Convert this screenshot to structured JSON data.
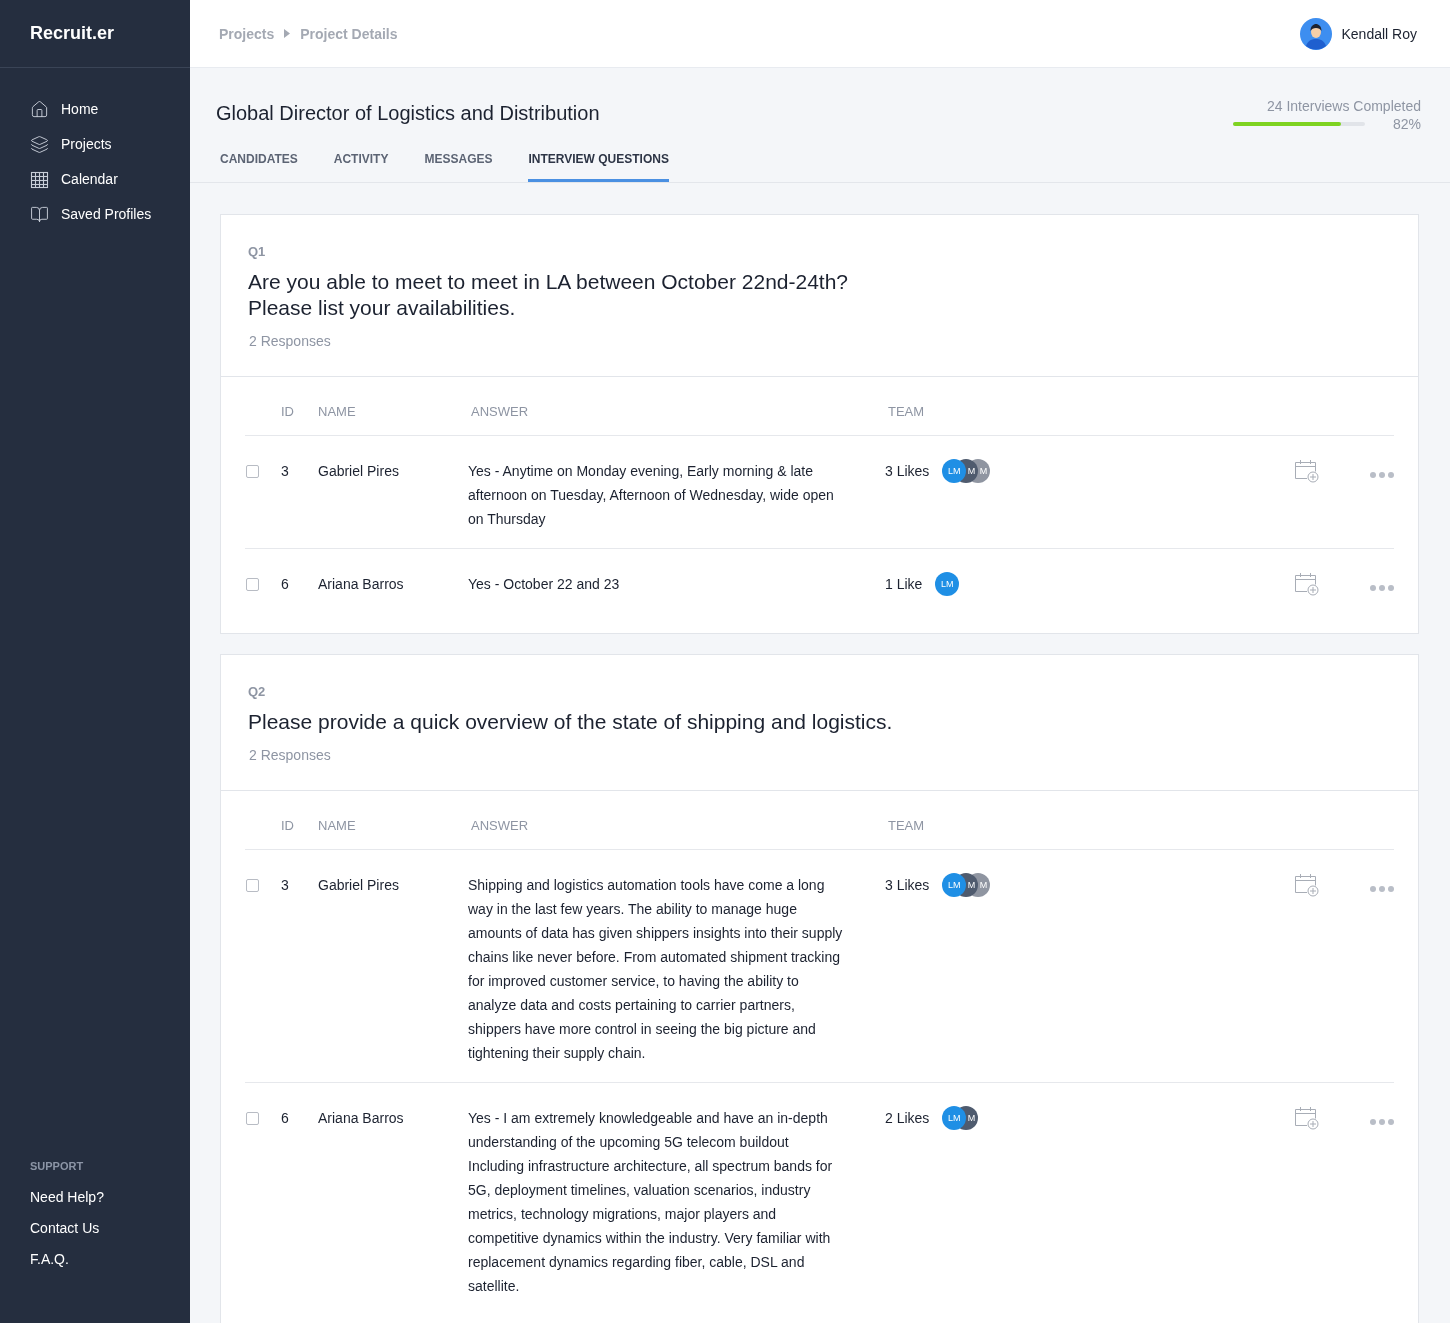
{
  "sidebar": {
    "logo": "Recruit.er",
    "items": [
      {
        "label": "Home",
        "kind": "home",
        "selected": false
      },
      {
        "label": "Projects",
        "kind": "layers",
        "selected": false
      },
      {
        "label": "Calendar",
        "kind": "calendar",
        "selected": false
      },
      {
        "label": "Saved Profiles",
        "kind": "book",
        "selected": false
      }
    ],
    "support": {
      "heading": "SUPPORT",
      "links": [
        "Need Help?",
        "Contact Us",
        "F.A.Q."
      ]
    }
  },
  "breadcrumb": [
    "Projects",
    "Project Details"
  ],
  "user": {
    "name": "Kendall Roy"
  },
  "project": {
    "title": "Global Director of Logistics and Distribution",
    "progress_label": "24 Interviews Completed",
    "level": 0.82,
    "percent": "82%"
  },
  "tabs": [
    {
      "label": "CANDIDATES",
      "selected": false
    },
    {
      "label": "ACTIVITY",
      "selected": false
    },
    {
      "label": "MESSAGES",
      "selected": false
    },
    {
      "label": "INTERVIEW QUESTIONS",
      "selected": true
    }
  ],
  "questions": [
    {
      "number": "Q1",
      "text": "Are you able to meet to meet in LA between October 22nd-24th?\nPlease list your availabilities.",
      "responses": "2 Responses",
      "columns": [
        "ID",
        "NAME",
        "ANSWER",
        "TEAM"
      ],
      "rows": [
        {
          "checked": false,
          "id": "3",
          "name": "Gabriel Pires",
          "answer": "Yes - Anytime on Monday evening, Early morning & late afternoon on Tuesday, Afternoon of Wednesday, wide open on Thursday",
          "likes": "3 Likes",
          "team": [
            {
              "initials": "LM",
              "color": "#1f8fe5"
            },
            {
              "initials": "M",
              "color": "#4f5b6e"
            },
            {
              "initials": "M",
              "color": "#8f95a1"
            }
          ]
        },
        {
          "checked": false,
          "id": "6",
          "name": "Ariana Barros",
          "answer": "Yes - October 22 and 23",
          "likes": "1 Like",
          "team": [
            {
              "initials": "LM",
              "color": "#1f8fe5"
            }
          ]
        }
      ]
    },
    {
      "number": "Q2",
      "text": "Please provide a quick overview of the state of shipping and logistics.",
      "responses": "2 Responses",
      "columns": [
        "ID",
        "NAME",
        "ANSWER",
        "TEAM"
      ],
      "rows": [
        {
          "checked": false,
          "id": "3",
          "name": "Gabriel Pires",
          "answer": "Shipping and logistics automation tools have come a long way in the last few years. The ability to manage huge amounts of data has given shippers insights into their supply chains like never before. From automated shipment tracking for improved customer service, to having the ability to analyze data and costs pertaining to carrier partners, shippers have more control in seeing the big picture and tightening their supply chain.",
          "likes": "3 Likes",
          "team": [
            {
              "initials": "LM",
              "color": "#1f8fe5"
            },
            {
              "initials": "M",
              "color": "#4f5b6e"
            },
            {
              "initials": "M",
              "color": "#8f95a1"
            }
          ]
        },
        {
          "checked": false,
          "id": "6",
          "name": "Ariana Barros",
          "answer": "Yes - I am extremely knowledgeable and have an in-depth understanding of the upcoming 5G telecom buildout Including infrastructure architecture, all spectrum bands for 5G, deployment timelines, valuation scenarios, industry metrics, technology migrations, major players and competitive dynamics within the industry. Very familiar with replacement dynamics regarding fiber, cable, DSL and satellite.",
          "likes": "2 Likes",
          "team": [
            {
              "initials": "LM",
              "color": "#1f8fe5"
            },
            {
              "initials": "M",
              "color": "#4f5b6e"
            }
          ]
        }
      ]
    }
  ]
}
